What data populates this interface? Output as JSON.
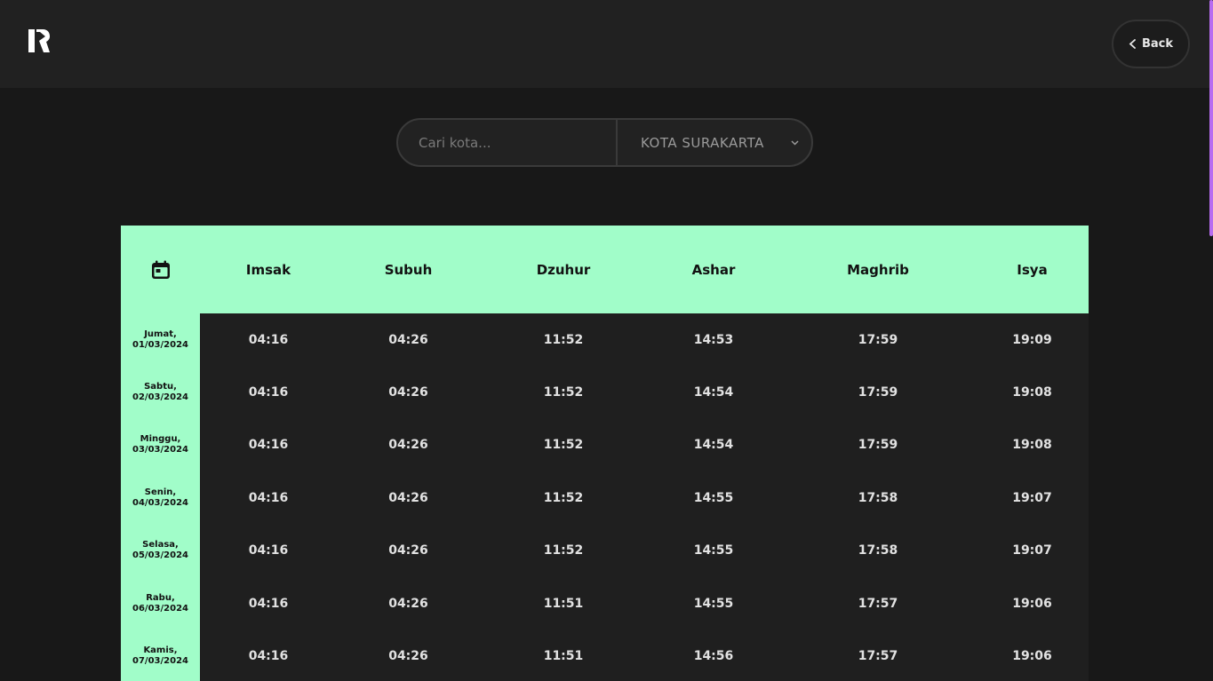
{
  "header": {
    "logo_icon": "brand-logo-icon",
    "back_label": "Back",
    "back_icon": "chevron-left-icon"
  },
  "search": {
    "placeholder": "Cari kota...",
    "selected_city": "KOTA SURAKARTA",
    "select_icon": "chevron-down-icon"
  },
  "colors": {
    "accent": "#a1fdc9",
    "background": "#181818",
    "panel": "#212121",
    "scroll_accent": "#b86cf0"
  },
  "schedule": {
    "header_icon": "calendar-icon",
    "columns": [
      "Imsak",
      "Subuh",
      "Dzuhur",
      "Ashar",
      "Maghrib",
      "Isya"
    ],
    "rows": [
      {
        "day": "Jumat,",
        "date": "01/03/2024",
        "times": [
          "04:16",
          "04:26",
          "11:52",
          "14:53",
          "17:59",
          "19:09"
        ]
      },
      {
        "day": "Sabtu,",
        "date": "02/03/2024",
        "times": [
          "04:16",
          "04:26",
          "11:52",
          "14:54",
          "17:59",
          "19:08"
        ]
      },
      {
        "day": "Minggu,",
        "date": "03/03/2024",
        "times": [
          "04:16",
          "04:26",
          "11:52",
          "14:54",
          "17:59",
          "19:08"
        ]
      },
      {
        "day": "Senin,",
        "date": "04/03/2024",
        "times": [
          "04:16",
          "04:26",
          "11:52",
          "14:55",
          "17:58",
          "19:07"
        ]
      },
      {
        "day": "Selasa,",
        "date": "05/03/2024",
        "times": [
          "04:16",
          "04:26",
          "11:52",
          "14:55",
          "17:58",
          "19:07"
        ]
      },
      {
        "day": "Rabu,",
        "date": "06/03/2024",
        "times": [
          "04:16",
          "04:26",
          "11:51",
          "14:55",
          "17:57",
          "19:06"
        ]
      },
      {
        "day": "Kamis,",
        "date": "07/03/2024",
        "times": [
          "04:16",
          "04:26",
          "11:51",
          "14:56",
          "17:57",
          "19:06"
        ]
      }
    ]
  }
}
